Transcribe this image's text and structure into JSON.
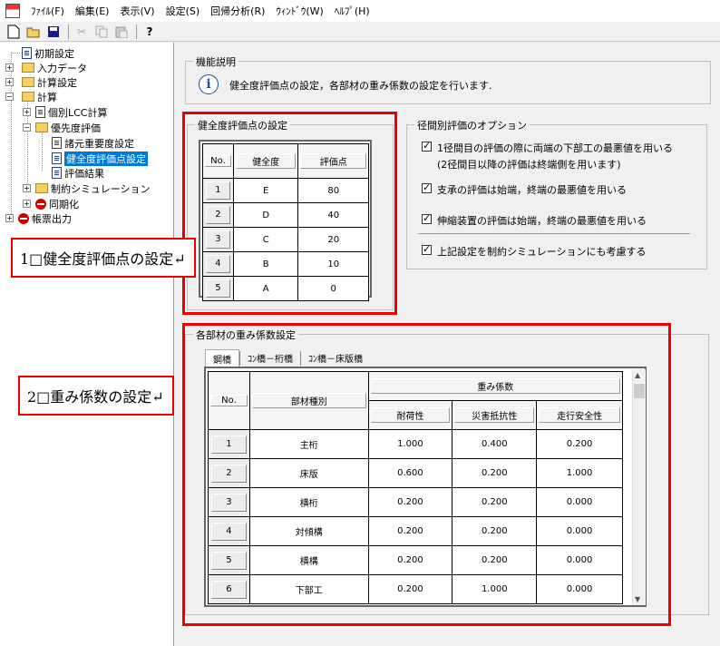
{
  "menu": [
    "ﾌｧｲﾙ(F)",
    "編集(E)",
    "表示(V)",
    "設定(S)",
    "回帰分析(R)",
    "ｳｨﾝﾄﾞｳ(W)",
    "ﾍﾙﾌﾟ(H)"
  ],
  "toolbar_icons": [
    "new-file-icon",
    "open-folder-icon",
    "save-icon",
    "cut-icon",
    "copy-icon",
    "paste-icon",
    "help-icon"
  ],
  "tree": {
    "n0": "初期設定",
    "n1": "入力データ",
    "n2": "計算設定",
    "n3": "計算",
    "n4": "個別LCC計算",
    "n5": "優先度評価",
    "n6": "諸元重要度設定",
    "n7": "健全度評価点設定",
    "n8": "評価結果",
    "n9": "制約シミュレーション",
    "n10": "同期化",
    "n11": "帳票出力"
  },
  "func_desc": {
    "title": "機能説明",
    "text": "健全度評価点の設定，各部材の重み係数の設定を行います."
  },
  "health": {
    "title": "健全度評価点の設定",
    "headers": [
      "No.",
      "健全度",
      "評価点"
    ],
    "rows": [
      [
        "1",
        "E",
        "80"
      ],
      [
        "2",
        "D",
        "40"
      ],
      [
        "3",
        "C",
        "20"
      ],
      [
        "4",
        "B",
        "10"
      ],
      [
        "5",
        "A",
        "0"
      ]
    ]
  },
  "options": {
    "title": "径間別評価のオプション",
    "opt1": "1径間目の評価の際に両端の下部工の最悪値を用いる",
    "opt1b": "(2径間目以降の評価は終端側を用います)",
    "opt2": "支承の評価は始端，終端の最悪値を用いる",
    "opt3": "伸縮装置の評価は始端，終端の最悪値を用いる",
    "opt4": "上記設定を制約シミュレーションにも考慮する"
  },
  "weights": {
    "title": "各部材の重み係数設定",
    "tabs": [
      "鋼橋",
      "ｺﾝ橋－桁橋",
      "ｺﾝ橋－床版橋"
    ],
    "h_no": "No.",
    "h_type": "部材種別",
    "h_group": "重み係数",
    "h_c1": "耐荷性",
    "h_c2": "災害抵抗性",
    "h_c3": "走行安全性",
    "rows": [
      [
        "1",
        "主桁",
        "1.000",
        "0.400",
        "0.200"
      ],
      [
        "2",
        "床版",
        "0.600",
        "0.200",
        "1.000"
      ],
      [
        "3",
        "横桁",
        "0.200",
        "0.200",
        "0.000"
      ],
      [
        "4",
        "対傾構",
        "0.200",
        "0.200",
        "0.000"
      ],
      [
        "5",
        "横構",
        "0.200",
        "0.200",
        "0.000"
      ],
      [
        "6",
        "下部工",
        "0.200",
        "1.000",
        "0.000"
      ]
    ]
  },
  "callouts": {
    "c1": "1□健全度評価点の設定↵",
    "c2": "2□重み係数の設定↵"
  },
  "colors": {
    "highlight": "#e00000",
    "selection": "#0078d7"
  }
}
